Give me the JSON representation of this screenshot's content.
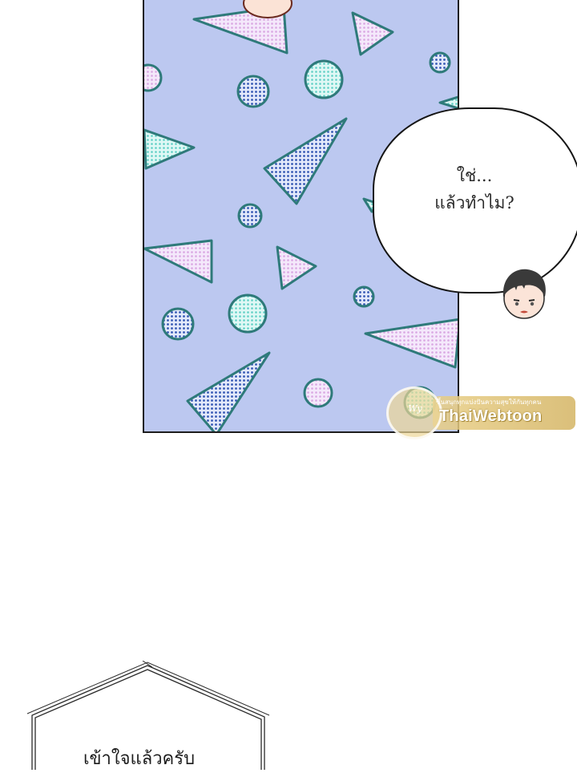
{
  "speech_bubble": {
    "line1": "ใช่...",
    "line2": "แล้วทำไม?"
  },
  "watermark": {
    "tagline": "ขึ้นสนุกทุกแบ่งปันความสุขให้กันทุกคน",
    "brand": "ThaiWebtoon"
  },
  "caption_box": {
    "text": "เข้าใจแล้วครับ"
  },
  "colors": {
    "panel_background": "#bcc8f0",
    "shape_outline": "#2e7a7a",
    "pink_dots": "#e3b6e6",
    "teal_dots": "#7fd8d2",
    "blue_dots": "#3f61b8",
    "watermark_gold": "#d9bb6c"
  }
}
